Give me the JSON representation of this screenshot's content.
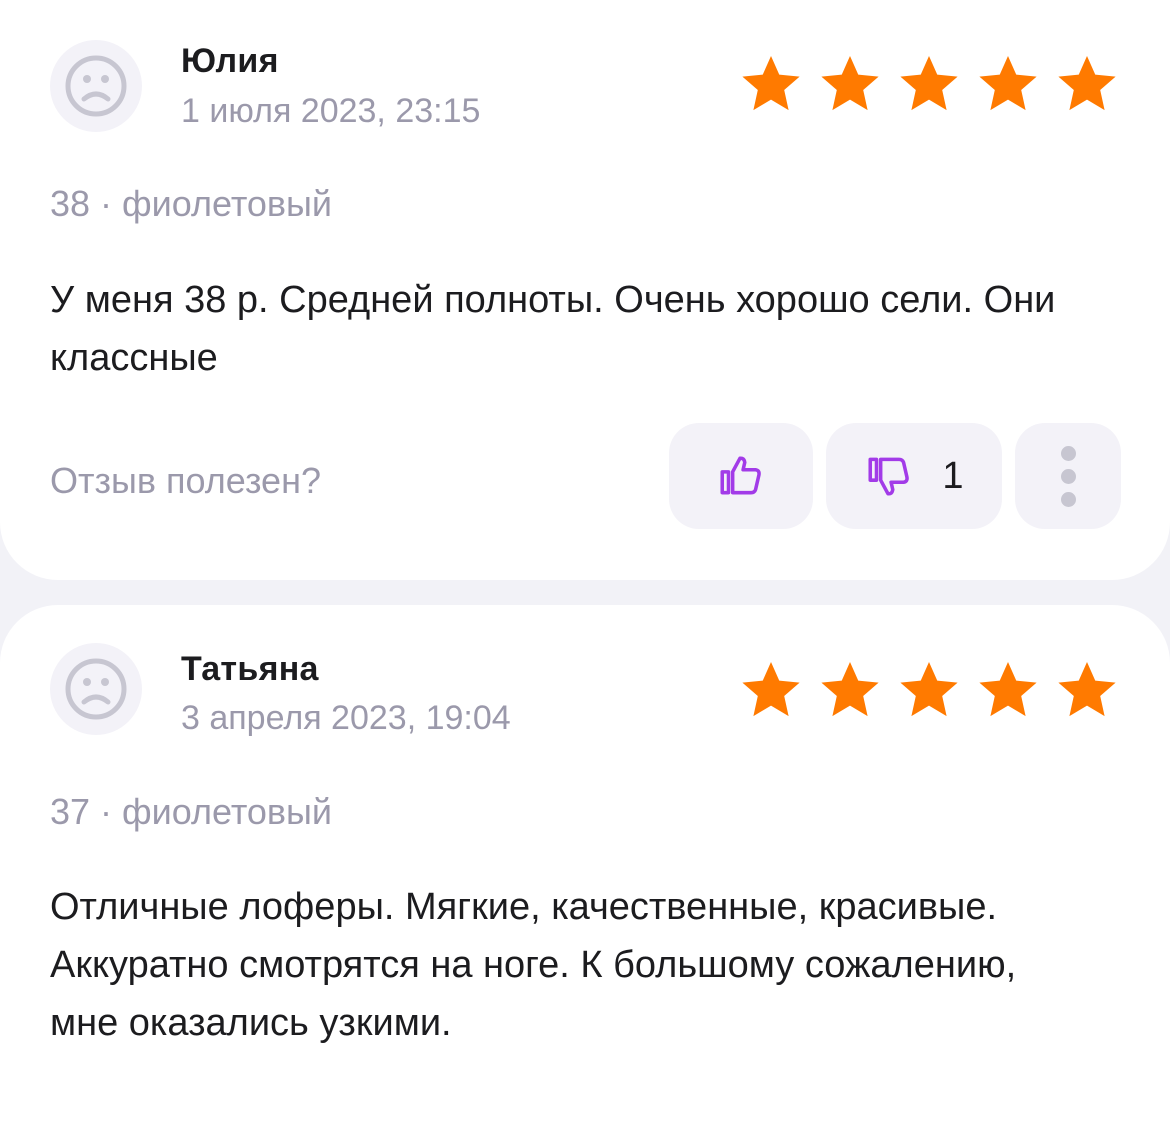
{
  "colors": {
    "star": "#ff7a00",
    "like_icon": "#a23be8",
    "muted": "#9b99ab"
  },
  "reviews": [
    {
      "author": "Юлия",
      "date": "1 июля 2023, 23:15",
      "rating": 5,
      "variant": "38 · фиолетовый",
      "text": "У меня 38 р. Средней полноты. Очень хорошо сели. Они классные",
      "helpful_question": "Отзыв полезен?",
      "dislikes": "1",
      "icons": {
        "avatar": "sad-face-icon",
        "like": "thumb-up-icon",
        "dislike": "thumb-down-icon",
        "more": "more-vertical-icon"
      }
    },
    {
      "author": "Татьяна",
      "date": "3 апреля 2023, 19:04",
      "rating": 5,
      "variant": "37 · фиолетовый",
      "text": "Отличные лоферы. Мягкие, качественные, красивые. Аккуратно смотрятся на ноге. К большому сожалению, мне оказались узкими.",
      "icons": {
        "avatar": "sad-face-icon"
      }
    }
  ]
}
